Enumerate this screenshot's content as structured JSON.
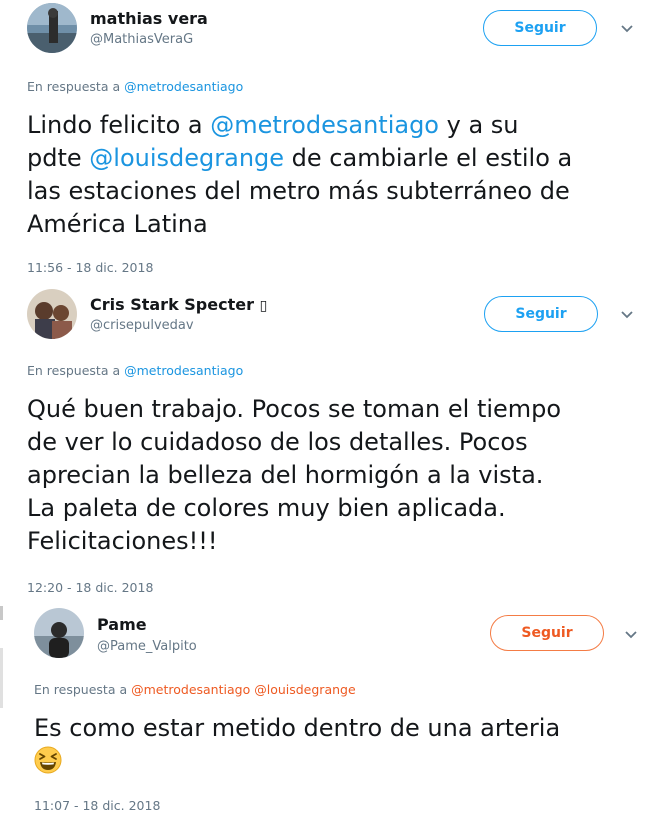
{
  "tweets": [
    {
      "display_name": "mathias vera",
      "handle": "@MathiasVeraG",
      "follow_label": "Seguir",
      "reply_prefix": "En respuesta a",
      "reply_mentions": [
        "@metrodesantiago"
      ],
      "body": {
        "line1_pre": "Lindo felicito a ",
        "line1_mention": "@metrodesantiago",
        "line1_post": " y a su",
        "line2_pre": "pdte ",
        "line2_mention": "@louisdegrange",
        "line2_post": " de cambiarle el estilo a",
        "line3": "las estaciones del metro más subterráneo de",
        "line4": "América Latina"
      },
      "timestamp": "11:56 - 18 dic. 2018"
    },
    {
      "display_name": "Cris Stark Specter",
      "name_glyph": "▯",
      "handle": "@crisepulvedav",
      "follow_label": "Seguir",
      "reply_prefix": "En respuesta a",
      "reply_mentions": [
        "@metrodesantiago"
      ],
      "body_lines": [
        "Qué buen trabajo. Pocos se toman el tiempo",
        "de ver lo cuidadoso de los detalles. Pocos",
        "aprecian la belleza del hormigón a la vista.",
        "La paleta de colores muy bien aplicada.",
        "Felicitaciones!!!"
      ],
      "timestamp": "12:20 - 18 dic. 2018"
    },
    {
      "display_name": "Pame",
      "handle": "@Pame_Valpito",
      "follow_label": "Seguir",
      "reply_prefix": "En respuesta a",
      "reply_mentions": [
        "@metrodesantiago",
        "@louisdegrange"
      ],
      "body_lines": [
        "Es como estar metido dentro de una arteria"
      ],
      "emoji": "grinning-squinting-face",
      "timestamp": "11:07 - 18 dic. 2018"
    }
  ],
  "colors": {
    "link_blue": "#1b95e0",
    "button_blue": "#1da1f2",
    "accent_orange": "#ee5a22",
    "secondary_gray": "#657786",
    "text_dark": "#14171a"
  }
}
